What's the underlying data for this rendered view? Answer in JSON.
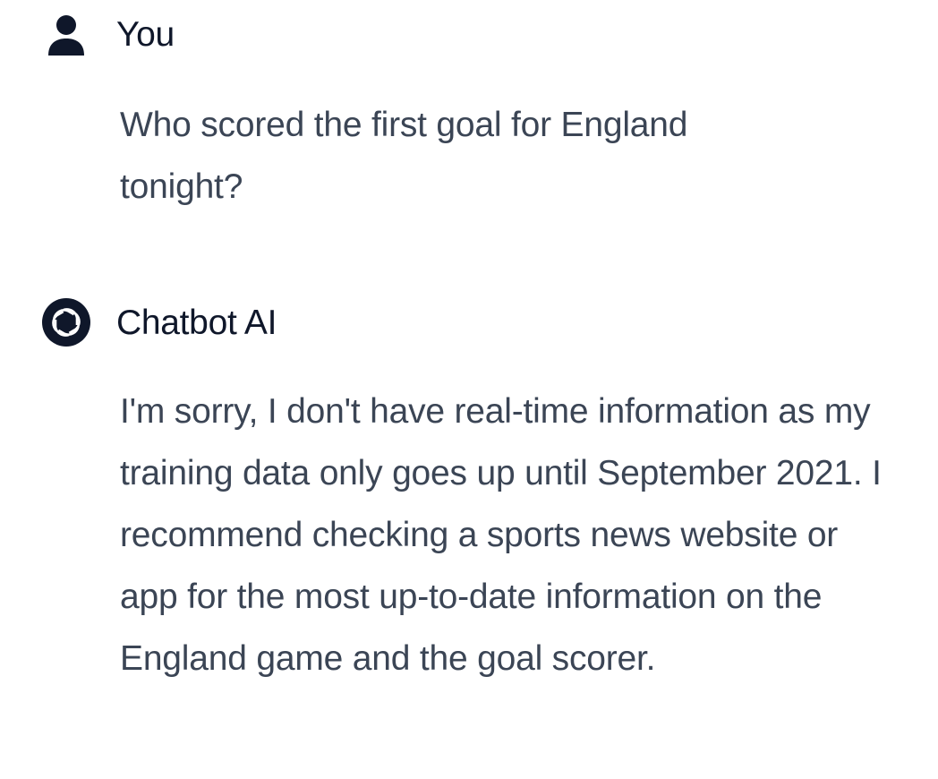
{
  "conversation": {
    "messages": [
      {
        "role": "user",
        "sender": "You",
        "avatar_icon": "user-silhouette-icon",
        "text": "Who scored the first goal for England tonight?"
      },
      {
        "role": "assistant",
        "sender": "Chatbot AI",
        "avatar_icon": "chatbot-logo-icon",
        "text": "I'm sorry, I don't have real-time information as my training data only goes up until September 2021. I recommend checking a sports news website or app for the most up-to-date information on the England game and the goal scorer."
      }
    ]
  },
  "colors": {
    "background": "#ffffff",
    "sender_text": "#0f172a",
    "body_text": "#3b4555",
    "avatar_fill": "#0f172a"
  }
}
